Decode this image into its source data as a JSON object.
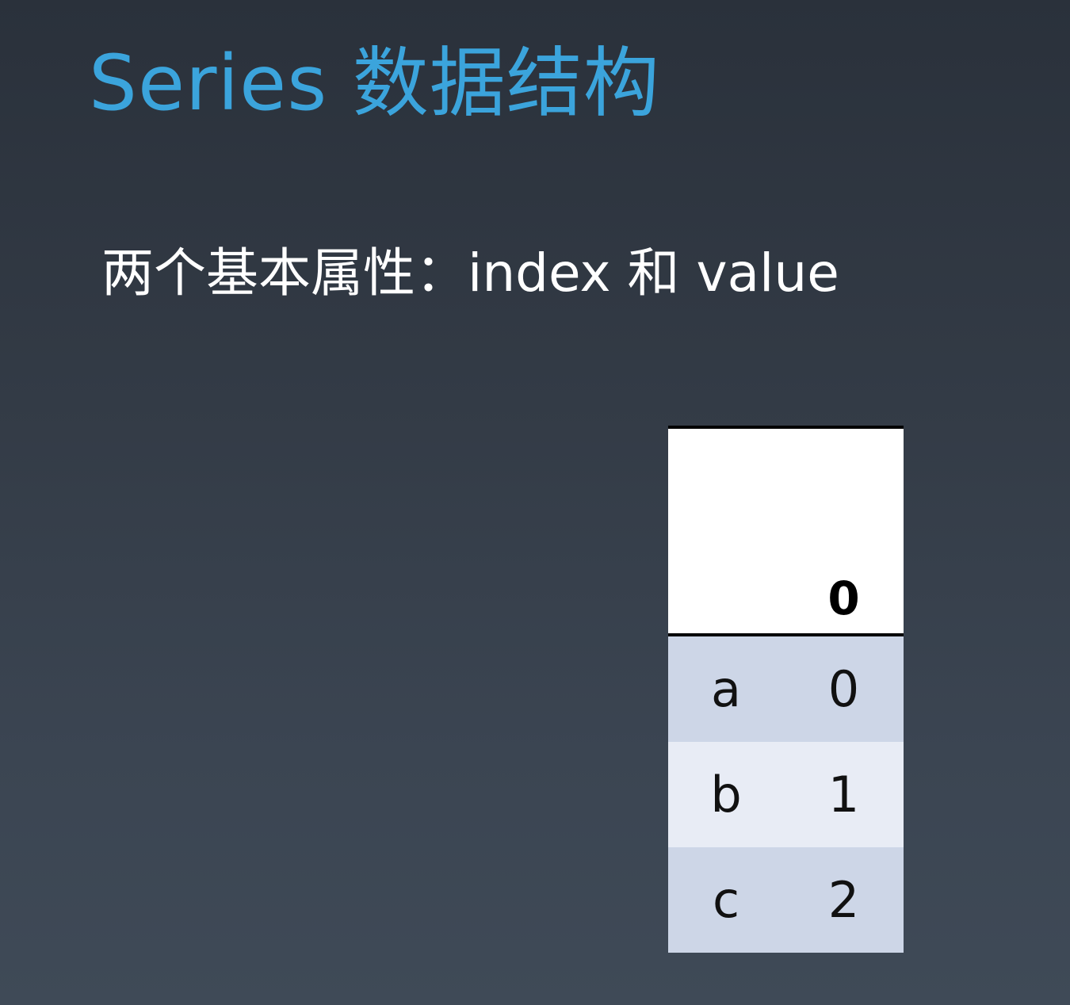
{
  "slide": {
    "title": "Series 数据结构",
    "subtitle": "两个基本属性：index 和 value"
  },
  "table": {
    "column_header": "0",
    "rows": [
      {
        "index": "a",
        "value": "0"
      },
      {
        "index": "b",
        "value": "1"
      },
      {
        "index": "c",
        "value": "2"
      }
    ]
  },
  "colors": {
    "title": "#3ba4dc",
    "subtitle": "#ffffff",
    "row_shade_dark": "#cdd6e7",
    "row_shade_light": "#e8ecf5"
  }
}
